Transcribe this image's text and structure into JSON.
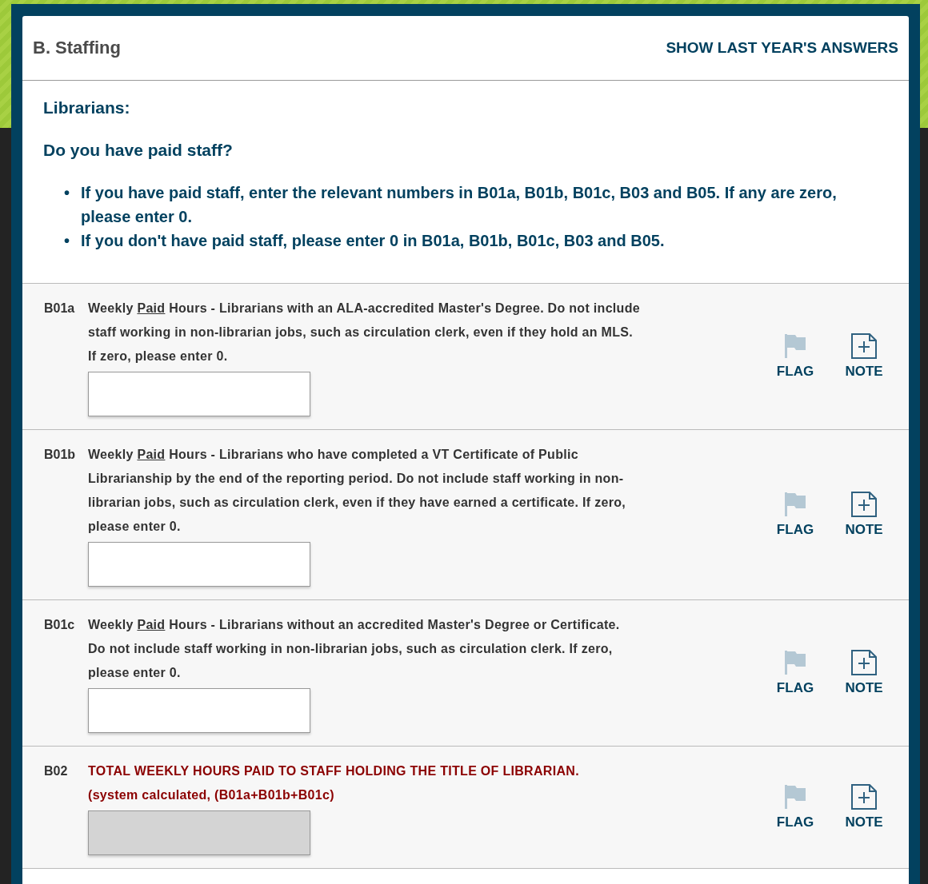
{
  "section": {
    "title": "B. Staffing",
    "action": "SHOW LAST YEAR'S ANSWERS"
  },
  "intro": {
    "heading": "Librarians:",
    "question": "Do you have paid staff?",
    "bullets": [
      {
        "marker": "•",
        "text": "If you have paid staff, enter the relevant numbers in B01a, B01b, B01c, B03 and B05. If any are zero, please enter 0."
      },
      {
        "marker": "•",
        "text": "If you don't have paid staff, please enter 0 in B01a, B01b, B01c, B03 and B05."
      }
    ]
  },
  "questions": [
    {
      "code": "B01a",
      "kind": "input",
      "text_before": "Weekly ",
      "text_underlined": "Paid",
      "text_after": " Hours - Librarians with an ALA-accredited Master's Degree. Do not include staff working in non-librarian jobs, such as circulation clerk, even if they hold an MLS. If zero, please enter 0.",
      "flagged": false,
      "flag_label": "FLAG",
      "note_label": "NOTE"
    },
    {
      "code": "B01b",
      "kind": "input",
      "text_before": "Weekly ",
      "text_underlined": "Paid",
      "text_after": " Hours - Librarians who have completed a VT Certificate of Public Librarianship by the end of the reporting period. Do not include staff working in non-librarian jobs, such as circulation clerk, even if they have earned a certificate. If zero, please enter 0.",
      "flagged": false,
      "flag_label": "FLAG",
      "note_label": "NOTE"
    },
    {
      "code": "B01c",
      "kind": "input",
      "text_before": "Weekly ",
      "text_underlined": "Paid",
      "text_after": " Hours - Librarians without an accredited Master's Degree or Certificate. Do not include staff working in non-librarian jobs, such as circulation clerk. If zero, please enter 0.",
      "flagged": false,
      "flag_label": "FLAG",
      "note_label": "NOTE"
    },
    {
      "code": "B02",
      "kind": "calculated",
      "text_before": "TOTAL WEEKLY HOURS PAID TO STAFF HOLDING THE TITLE OF LIBRARIAN.",
      "subtext": "(system calculated, (B01a+B01b+B01c)",
      "flagged": false,
      "flag_label": "FLAG",
      "note_label": "NOTE"
    }
  ]
}
